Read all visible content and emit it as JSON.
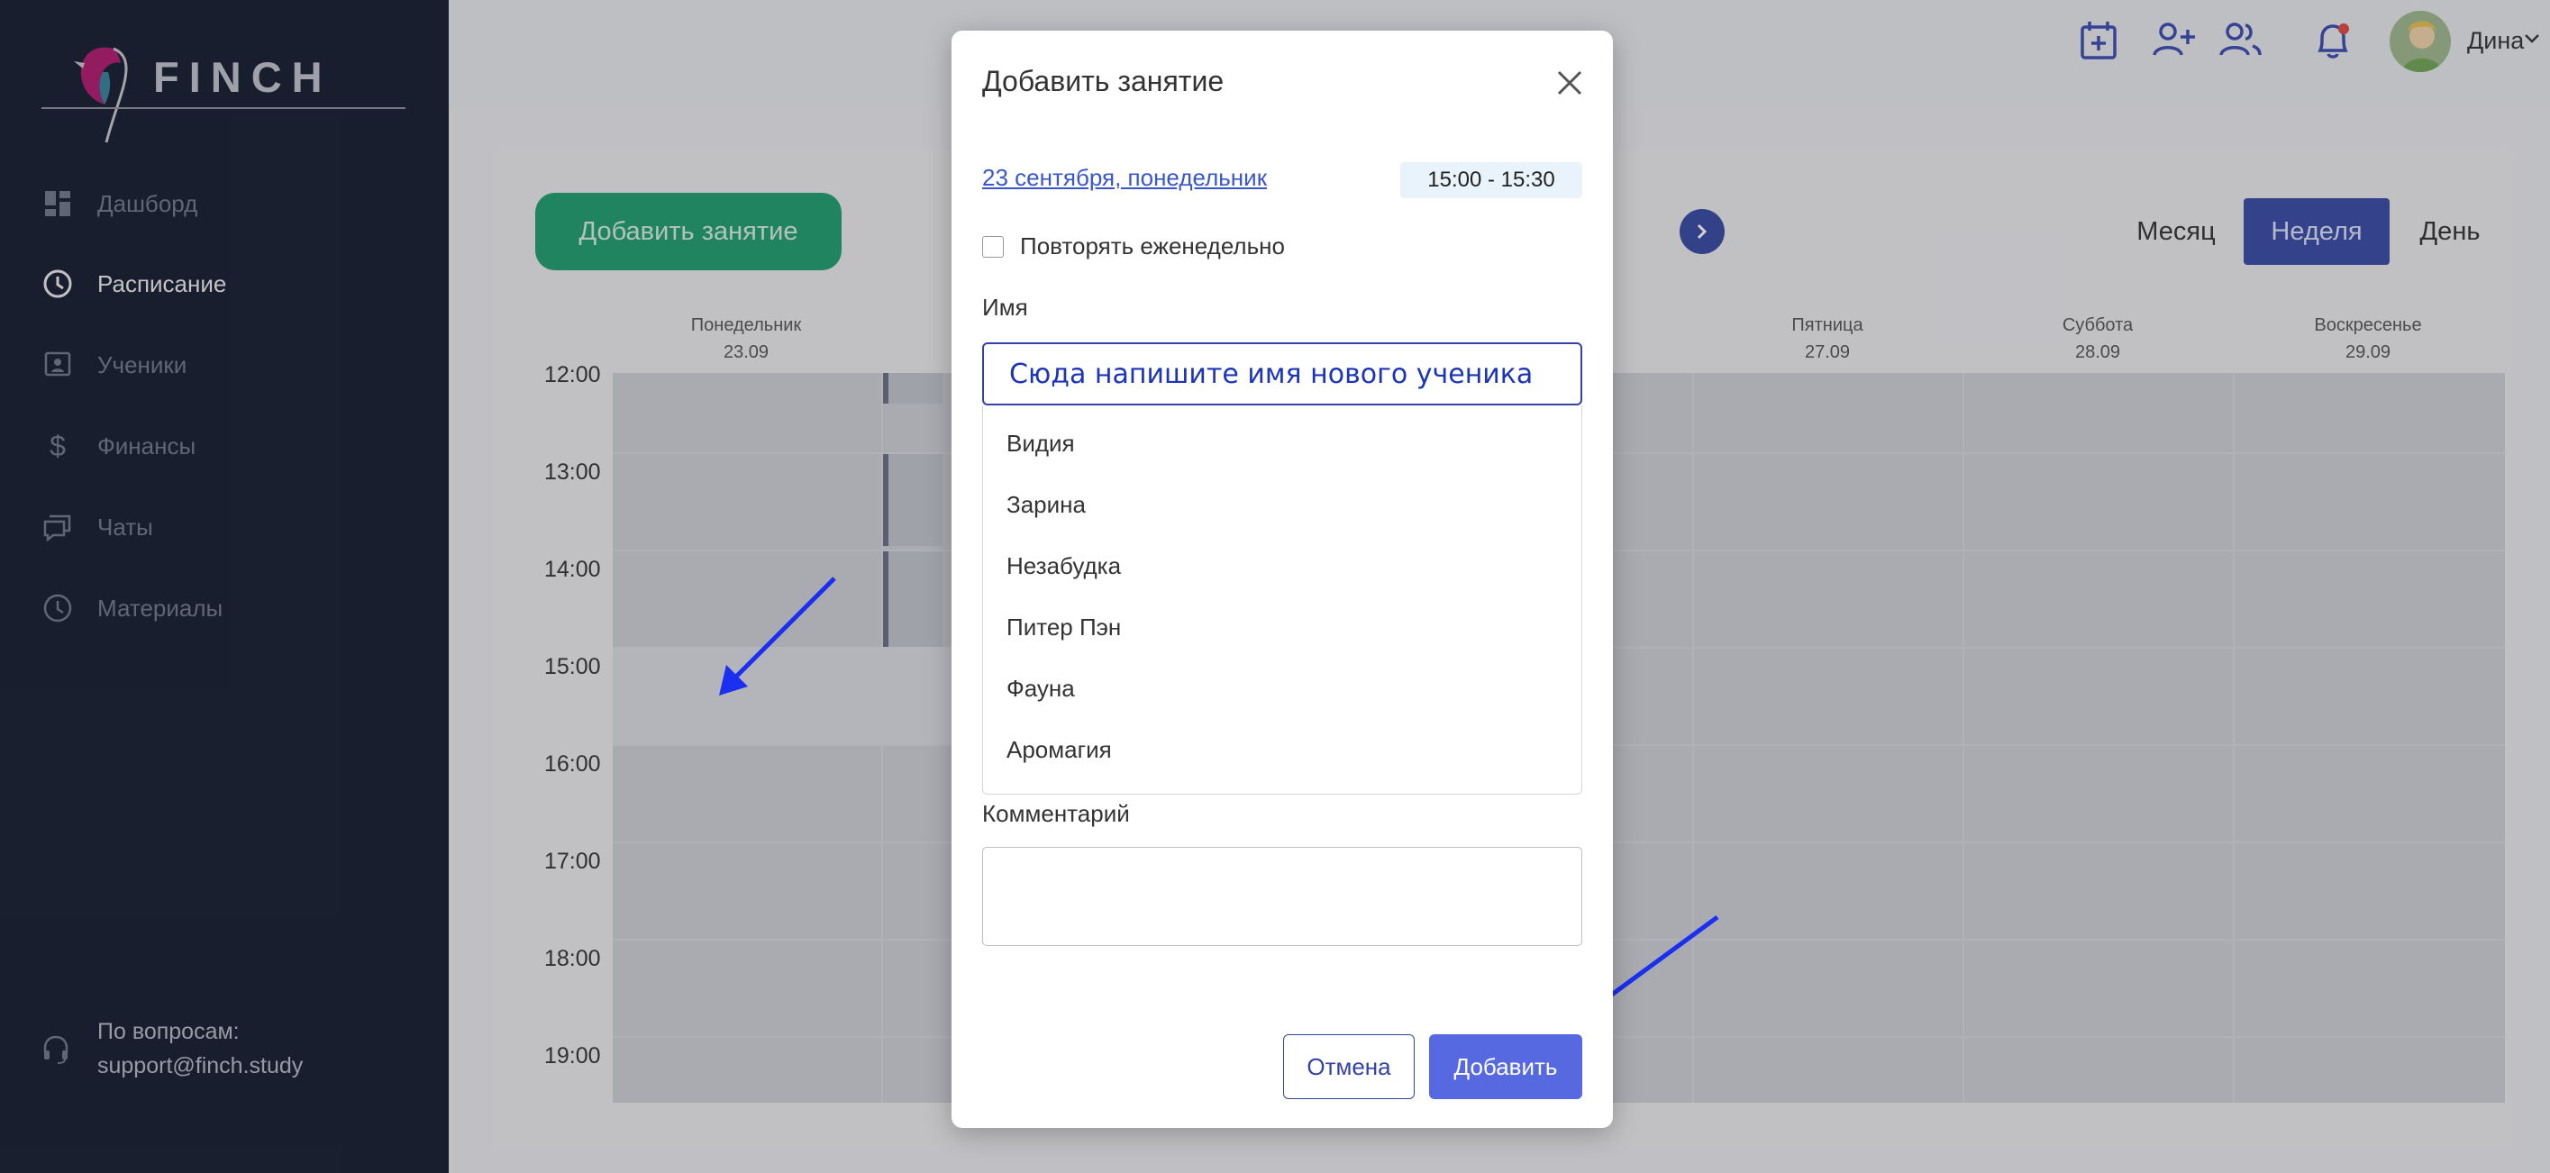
{
  "brand": {
    "name": "FINCH"
  },
  "sidebar": {
    "items": [
      {
        "label": "Дашборд",
        "icon": "dashboard-icon"
      },
      {
        "label": "Расписание",
        "icon": "clock-icon"
      },
      {
        "label": "Ученики",
        "icon": "student-icon"
      },
      {
        "label": "Финансы",
        "icon": "dollar-icon"
      },
      {
        "label": "Чаты",
        "icon": "chat-icon"
      },
      {
        "label": "Материалы",
        "icon": "materials-icon"
      }
    ],
    "active_index": 1,
    "support": {
      "title": "По вопросам:",
      "email": "support@finch.study"
    }
  },
  "topbar": {
    "icons": [
      "calendar-add-icon",
      "add-user-icon",
      "users-icon",
      "bell-icon"
    ],
    "user_name": "Дина"
  },
  "schedule": {
    "add_button": "Добавить занятие",
    "views": {
      "month": "Месяц",
      "week": "Неделя",
      "day": "День",
      "active": "week"
    },
    "partial_period_text": "-",
    "days": [
      {
        "name": "Понедельник",
        "date": "23.09"
      },
      {
        "name": "Пятница",
        "date": "27.09"
      },
      {
        "name": "Суббота",
        "date": "28.09"
      },
      {
        "name": "Воскресенье",
        "date": "29.09"
      }
    ],
    "hours": [
      "12:00",
      "13:00",
      "14:00",
      "15:00",
      "16:00",
      "17:00",
      "18:00",
      "19:00"
    ]
  },
  "modal": {
    "title": "Добавить занятие",
    "date_link": "23 сентября, понедельник",
    "time": "15:00 - 15:30",
    "repeat_label": "Повторять еженедельно",
    "name_label": "Имя",
    "name_input_hint": "Сюда напишите имя нового ученика",
    "options": [
      "Видия",
      "Зарина",
      "Незабудка",
      "Питер Пэн",
      "Фауна",
      "Аромагия"
    ],
    "comment_label": "Комментарий",
    "comment_value": "",
    "cancel": "Отмена",
    "submit": "Добавить"
  },
  "colors": {
    "sidebar_bg": "#1e2538",
    "accent": "#5669e0",
    "primary_dark": "#3849a4",
    "green": "#1f9e6e",
    "annotation_arrow": "#1b2ff0"
  }
}
